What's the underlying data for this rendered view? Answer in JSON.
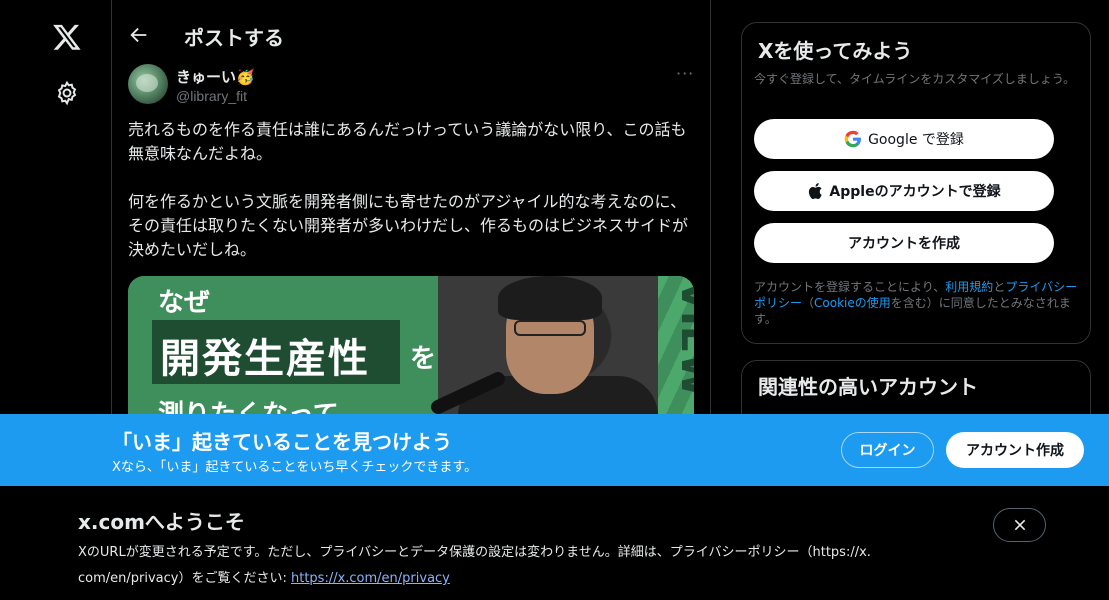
{
  "nav": {
    "logo_icon": "x-logo-icon",
    "settings_icon": "gear-icon"
  },
  "header": {
    "title": "ポストする",
    "back_icon": "arrow-left-icon"
  },
  "post": {
    "display_name": "きゅーい🥳",
    "handle": "@library_fit",
    "more_label": "···",
    "text": "売れるものを作る責任は誰にあるんだっけっていう議論がない限り、この話も無意味なんだよね。\n\n何を作るかという文脈を開発者側にも寄せたのがアジャイル的な考えなのに、その責任は取りたくない開発者が多いわけだし、作るものはビジネスサイドが決めたいだしね。",
    "media": {
      "line1": "なぜ",
      "line2": "開発生産性",
      "particle": "を",
      "line3": "測りたくなって",
      "side_text": "VIEW"
    }
  },
  "signup_card": {
    "title": "Xを使ってみよう",
    "subtitle": "今すぐ登録して、タイムラインをカスタマイズしましょう。",
    "google_label": "Google で登録",
    "apple_label": "Appleのアカウントで登録",
    "create_label": "アカウントを作成",
    "terms_prefix": "アカウントを登録することにより、",
    "terms_link": "利用規約",
    "terms_and": "と",
    "privacy_link": "プライバシーポリシー",
    "terms_mid": "（",
    "cookie_link": "Cookieの使用",
    "terms_suffix": "を含む）に同意したとみなされます。"
  },
  "related_card": {
    "title": "関連性の高いアカウント"
  },
  "banner": {
    "title": "「いま」起きていることを見つけよう",
    "subtitle": "Xなら、「いま」起きていることをいち早くチェックできます。",
    "login_label": "ログイン",
    "signup_label": "アカウント作成",
    "color": "#1d9bf0"
  },
  "notice": {
    "title": "x.comへようこそ",
    "text_line1": "XのURLが変更される予定です。ただし、プライバシーとデータ保護の設定は変わりません。詳細は、プライバシーポリシー（https://x.",
    "text_line2_prefix": "com/en/privacy）をご覧ください: ",
    "link": "https://x.com/en/privacy",
    "close_icon": "close-icon"
  }
}
